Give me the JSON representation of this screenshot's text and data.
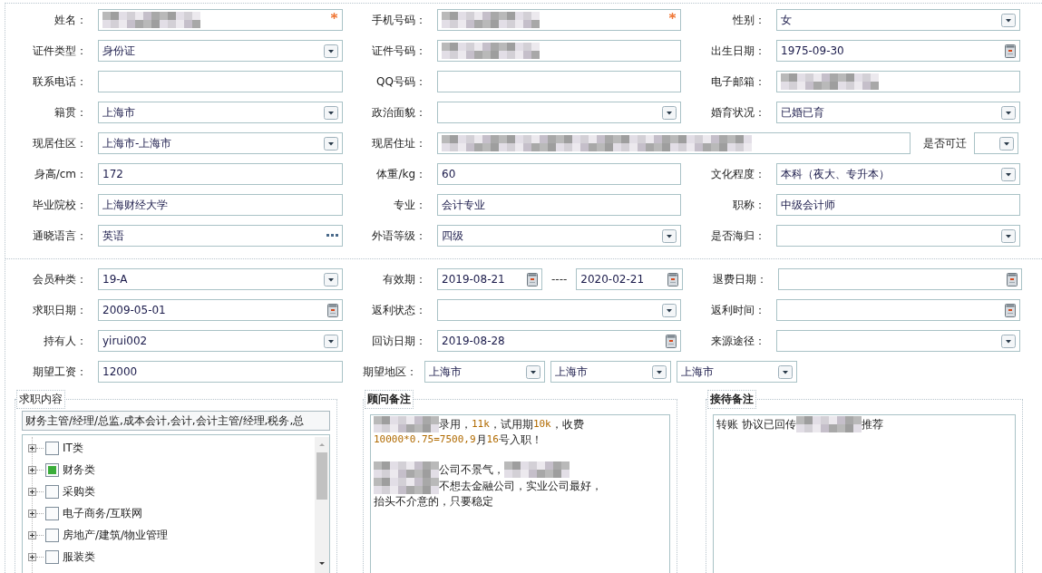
{
  "personal_rows": [
    [
      {
        "label": "姓名：",
        "kind": "text",
        "redacted": true,
        "required": true
      },
      {
        "label": "手机号码：",
        "kind": "text",
        "redacted": true,
        "required": true
      },
      {
        "label": "性别：",
        "kind": "select",
        "value": "女"
      }
    ],
    [
      {
        "label": "证件类型：",
        "kind": "select",
        "value": "身份证"
      },
      {
        "label": "证件号码：",
        "kind": "text",
        "redacted": true
      },
      {
        "label": "出生日期：",
        "kind": "date",
        "value": "1975-09-30"
      }
    ],
    [
      {
        "label": "联系电话：",
        "kind": "text"
      },
      {
        "label": "QQ号码：",
        "kind": "text"
      },
      {
        "label": "电子邮箱：",
        "kind": "text",
        "redacted": true
      }
    ],
    [
      {
        "label": "籍贯：",
        "kind": "select",
        "value": "上海市"
      },
      {
        "label": "政治面貌：",
        "kind": "select"
      },
      {
        "label": "婚育状况：",
        "kind": "select",
        "value": "已婚已育"
      }
    ],
    [
      {
        "label": "现居住区：",
        "kind": "select",
        "value": "上海市-上海市"
      },
      {
        "label": "现居住址：",
        "kind": "wide-text",
        "redacted": true
      },
      {
        "label": "是否可迁",
        "kind": "mini-select"
      }
    ],
    [
      {
        "label": "身高/cm：",
        "kind": "text",
        "value": "172"
      },
      {
        "label": "体重/kg：",
        "kind": "text",
        "value": "60"
      },
      {
        "label": "文化程度：",
        "kind": "select",
        "value": "本科（夜大、专升本）"
      }
    ],
    [
      {
        "label": "毕业院校：",
        "kind": "text",
        "value": "上海财经大学"
      },
      {
        "label": "专业：",
        "kind": "text",
        "value": "会计专业"
      },
      {
        "label": "职称：",
        "kind": "text",
        "value": "中级会计师"
      }
    ],
    [
      {
        "label": "通晓语言：",
        "kind": "picker",
        "value": "英语"
      },
      {
        "label": "外语等级：",
        "kind": "select",
        "value": "四级"
      },
      {
        "label": "是否海归：",
        "kind": "select"
      }
    ]
  ],
  "member_rows": [
    [
      {
        "label": "会员种类：",
        "kind": "select",
        "value": "19-A"
      },
      {
        "label": "有效期：",
        "kind": "date-range",
        "values": [
          "2019-08-21",
          "2020-02-21"
        ],
        "separator": "----"
      },
      {
        "label": "退费日期：",
        "kind": "date"
      }
    ],
    [
      {
        "label": "求职日期：",
        "kind": "date",
        "value": "2009-05-01"
      },
      {
        "label": "返利状态：",
        "kind": "select"
      },
      {
        "label": "返利时间：",
        "kind": "date"
      }
    ],
    [
      {
        "label": "持有人：",
        "kind": "select",
        "value": "yirui002"
      },
      {
        "label": "回访日期：",
        "kind": "date",
        "value": "2019-08-28"
      },
      {
        "label": "来源途径：",
        "kind": "select"
      }
    ],
    [
      {
        "label": "期望工资：",
        "kind": "text",
        "value": "12000"
      },
      {
        "label": "期望地区：",
        "kind": "region",
        "values": [
          "上海市",
          "上海市",
          "上海市"
        ]
      }
    ]
  ],
  "job_content": {
    "title": "求职内容",
    "value": "财务主管/经理/总监,成本会计,会计,会计主管/经理,税务,总",
    "tree": [
      {
        "label": "IT类",
        "checked": false,
        "expanded": false
      },
      {
        "label": "财务类",
        "checked": true,
        "expanded": false
      },
      {
        "label": "采购类",
        "checked": false,
        "expanded": false
      },
      {
        "label": "电子商务/互联网",
        "checked": false,
        "expanded": false
      },
      {
        "label": "房地产/建筑/物业管理",
        "checked": false,
        "expanded": false
      },
      {
        "label": "服装类",
        "checked": false,
        "expanded": false
      }
    ]
  },
  "advisor_note": {
    "title": "顾问备注",
    "lines": [
      {
        "segments": [
          {
            "kind": "redacted"
          },
          {
            "kind": "plain",
            "text": "录用，"
          },
          {
            "kind": "number",
            "text": "11k"
          },
          {
            "kind": "plain",
            "text": "，试用期"
          },
          {
            "kind": "number",
            "text": "10k"
          },
          {
            "kind": "plain",
            "text": "，收费"
          }
        ]
      },
      {
        "segments": [
          {
            "kind": "number",
            "text": "10000*0.75=7500,9"
          },
          {
            "kind": "plain",
            "text": "月"
          },
          {
            "kind": "number",
            "text": "16"
          },
          {
            "kind": "plain",
            "text": "号入职！"
          }
        ]
      },
      {
        "gap_before": true,
        "segments": [
          {
            "kind": "redacted"
          },
          {
            "kind": "plain",
            "text": "公司不景气，"
          },
          {
            "kind": "redacted"
          }
        ]
      },
      {
        "segments": [
          {
            "kind": "redacted"
          },
          {
            "kind": "plain",
            "text": "不想去金融公司，实业公司最好，"
          }
        ]
      },
      {
        "segments": [
          {
            "kind": "plain",
            "text": "抬头不介意的，只要稳定"
          }
        ]
      }
    ]
  },
  "reception_note": {
    "title": "接待备注",
    "lines": [
      {
        "segments": [
          {
            "kind": "plain",
            "text": "转账 协议已回传"
          },
          {
            "kind": "redacted"
          },
          {
            "kind": "plain",
            "text": "推荐"
          }
        ]
      }
    ]
  }
}
